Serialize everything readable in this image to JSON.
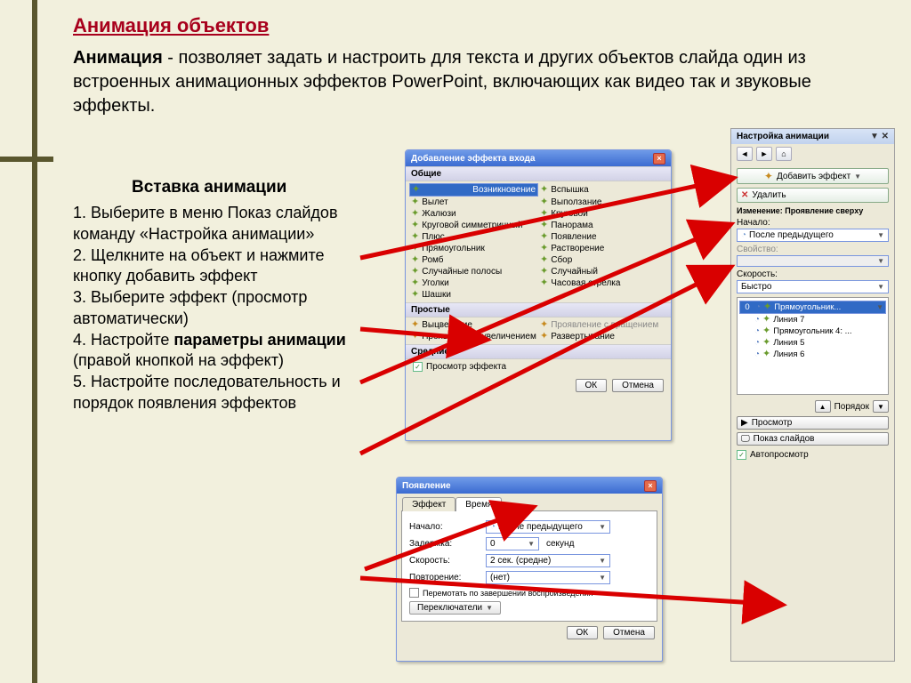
{
  "title": "Анимация объектов",
  "intro_bold": "Анимация",
  "intro_rest": " - позволяет задать и настроить для текста и других объектов слайда один из встроенных анимационных эффектов PowerPoint, включающих как видео так и звуковые эффекты.",
  "subtitle": "Вставка анимации",
  "steps_html": "1. Выберите в меню Показ слайдов команду «Настройка анимации»<br>2. Щелкните на объект и нажмите кнопку добавить эффект<br>3. Выберите эффект (просмотр автоматически)<br>4. Настройте <b>параметры анимации</b> (правой кнопкой на эффект)<br>5. Настройте последовательность и порядок появления эффектов",
  "dlg1": {
    "title": "Добавление эффекта входа",
    "group1": "Общие",
    "effects1": [
      "Возникновение",
      "Вспышка",
      "Вылет",
      "Выползание",
      "Жалюзи",
      "Круговой",
      "Круговой симметричный",
      "Панорама",
      "Плюс",
      "Появление",
      "Прямоугольник",
      "Растворение",
      "Ромб",
      "Сбор",
      "Случайные полосы",
      "Случайный",
      "Уголки",
      "Часовая стрелка",
      "Шашки"
    ],
    "group2": "Простые",
    "effects2": [
      "Выцветание",
      "Проявление с вращением",
      "Проявление с увеличением",
      "Развертывание"
    ],
    "group3": "Средние",
    "preview": "Просмотр эффекта",
    "ok": "ОК",
    "cancel": "Отмена"
  },
  "dlg2": {
    "title": "Появление",
    "tab1": "Эффект",
    "tab2": "Время",
    "nachalo_lbl": "Начало:",
    "nachalo_val": "После предыдущего",
    "zaderzhka_lbl": "Задержка:",
    "zaderzhka_val": "0",
    "zaderzhka_unit": "секунд",
    "skorost_lbl": "Скорость:",
    "skorost_val": "2 сек. (средне)",
    "povtor_lbl": "Повторение:",
    "povtor_val": "(нет)",
    "perem": "Перемотать по завершении воспроизведения",
    "pereключатели": "Переключатели",
    "ok": "ОК",
    "cancel": "Отмена"
  },
  "tp": {
    "header": "Настройка анимации",
    "add": "Добавить эффект",
    "del": "Удалить",
    "change": "Изменение: Проявление сверху",
    "nachalo_lbl": "Начало:",
    "nachalo_val": "После предыдущего",
    "svoystvo_lbl": "Свойство:",
    "skorost_lbl": "Скорость:",
    "skorost_val": "Быстро",
    "items": [
      {
        "idx": "0",
        "star": "g",
        "label": "Прямоугольник..."
      },
      {
        "idx": "",
        "star": "g",
        "label": "Линия 7"
      },
      {
        "idx": "",
        "star": "g",
        "label": "Прямоугольник 4: ..."
      },
      {
        "idx": "",
        "star": "g",
        "label": "Линия 5"
      },
      {
        "idx": "",
        "star": "g",
        "label": "Линия 6"
      }
    ],
    "order": "Порядок",
    "playbtn": "Просмотр",
    "slideshow": "Показ слайдов",
    "autopreview": "Автопросмотр"
  }
}
